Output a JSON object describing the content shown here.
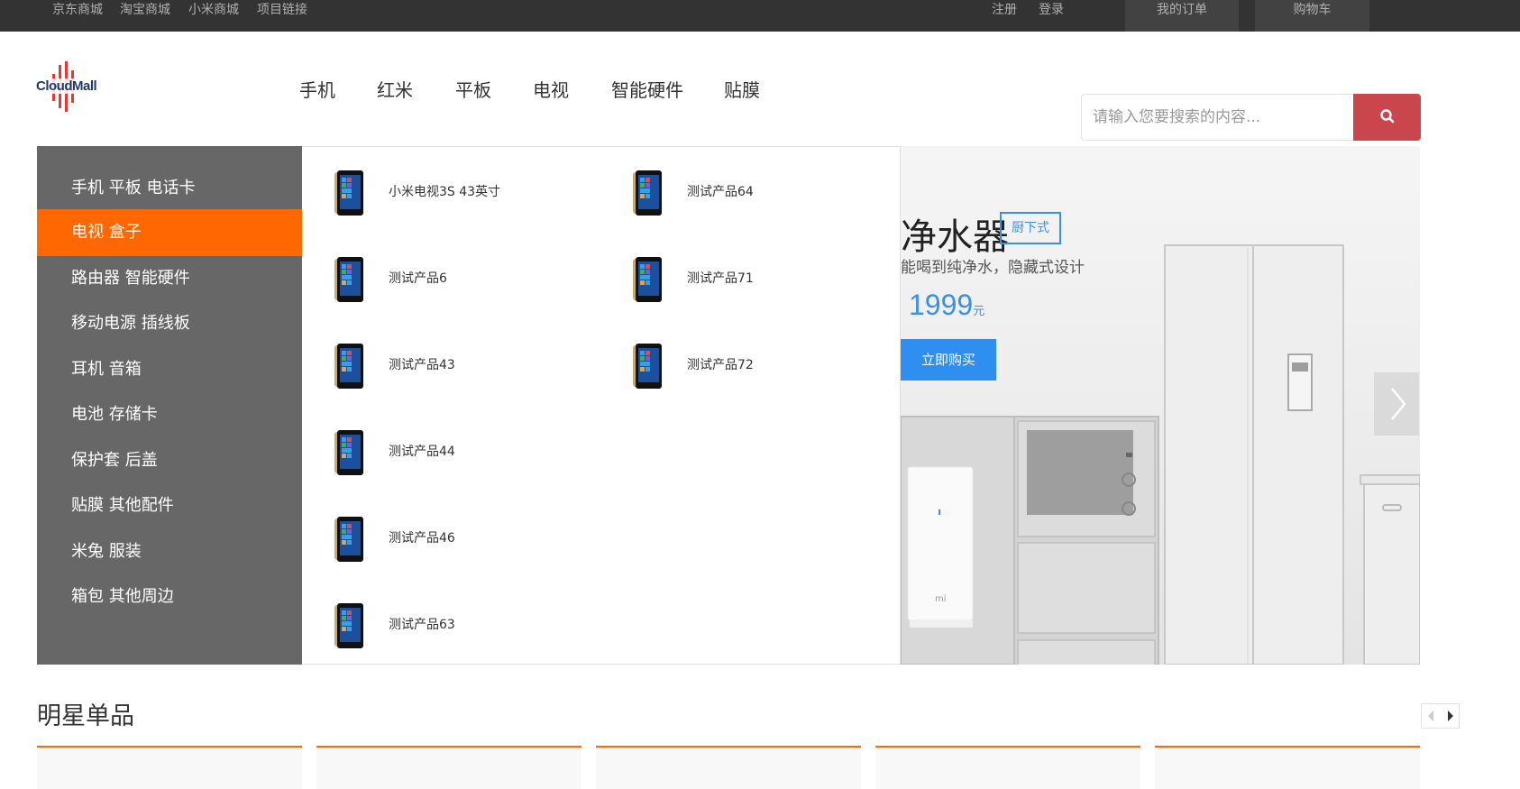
{
  "topbar": {
    "links": [
      "京东商城",
      "淘宝商城",
      "小米商城",
      "项目链接"
    ],
    "register": "注册",
    "login": "登录",
    "orders": "我的订单",
    "cart": "购物车"
  },
  "logo": {
    "text": "CloudMall"
  },
  "nav": {
    "items": [
      "手机",
      "红米",
      "平板",
      "电视",
      "智能硬件",
      "贴膜"
    ]
  },
  "search": {
    "placeholder": "请输入您要搜索的内容..."
  },
  "categories": {
    "items": [
      "手机 平板 电话卡",
      "电视 盒子",
      "路由器 智能硬件",
      "移动电源 插线板",
      "耳机 音箱",
      "电池 存储卡",
      "保护套 后盖",
      "贴膜 其他配件",
      "米兔 服装",
      "箱包 其他周边"
    ],
    "active_index": 1
  },
  "dropdown": {
    "col1": [
      "小米电视3S 43英寸",
      "测试产品6",
      "测试产品43",
      "测试产品44",
      "测试产品46",
      "测试产品63"
    ],
    "col2": [
      "测试产品64",
      "测试产品71",
      "测试产品72"
    ]
  },
  "banner": {
    "title": "净水器",
    "tag": "厨下式",
    "subtitle": "能喝到纯净水，隐藏式设计",
    "price": "1999",
    "price_unit": "元",
    "buy_label": "立即购买",
    "device_mark": "mi"
  },
  "star": {
    "title": "明星单品"
  },
  "colors": {
    "accent": "#ff6700",
    "sidebar": "#676767",
    "topbar": "#333333",
    "search_button": "#c9474c",
    "banner_blue": "#2f8ff0"
  }
}
